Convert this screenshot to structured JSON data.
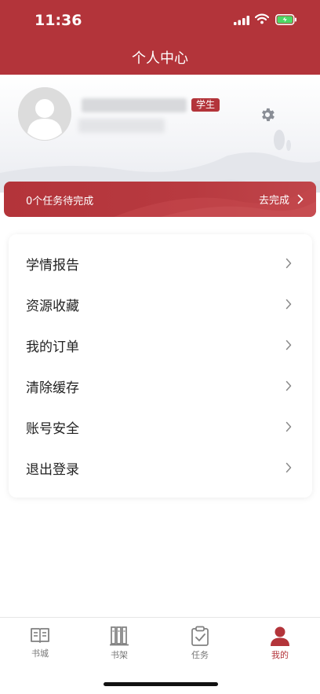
{
  "status": {
    "time": "11:36"
  },
  "header": {
    "title": "个人中心"
  },
  "profile": {
    "role_badge": "学生"
  },
  "task_banner": {
    "text": "0个任务待完成",
    "action": "去完成"
  },
  "menu": {
    "items": [
      {
        "label": "学情报告"
      },
      {
        "label": "资源收藏"
      },
      {
        "label": "我的订单"
      },
      {
        "label": "清除缓存"
      },
      {
        "label": "账号安全"
      },
      {
        "label": "退出登录"
      }
    ]
  },
  "tabbar": {
    "tabs": [
      {
        "label": "书城",
        "icon": "book-open-icon"
      },
      {
        "label": "书架",
        "icon": "bookshelf-icon"
      },
      {
        "label": "任务",
        "icon": "clipboard-check-icon"
      },
      {
        "label": "我的",
        "icon": "user-icon",
        "active": true
      }
    ]
  },
  "colors": {
    "accent": "#b3343a",
    "battery_green": "#4cd964"
  }
}
